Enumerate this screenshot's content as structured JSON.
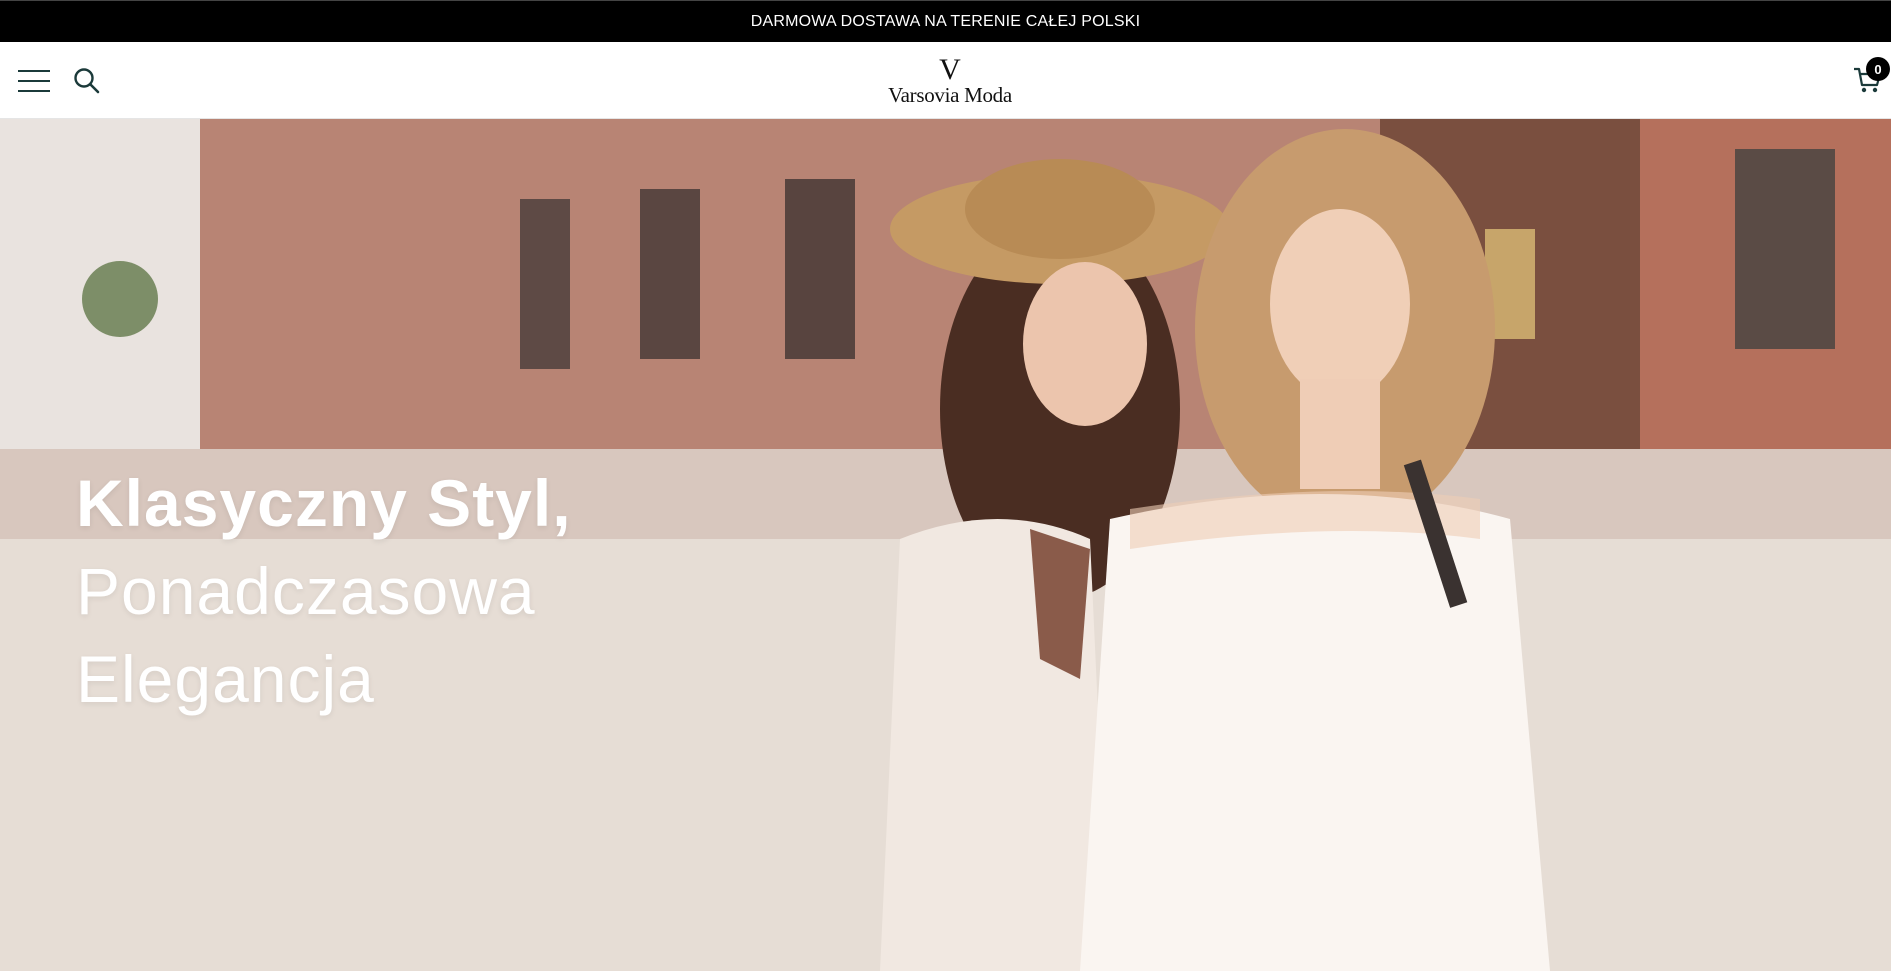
{
  "announcement": {
    "text": "DARMOWA DOSTAWA NA TERENIE CAŁEJ POLSKI"
  },
  "header": {
    "logo_mark": "V",
    "logo_text": "Varsovia Moda",
    "cart_count": "0",
    "icons": {
      "menu": "hamburger-menu-icon",
      "search": "search-icon",
      "cart": "cart-icon"
    }
  },
  "hero": {
    "headline_lines": [
      "Klasyczny Styl,",
      "Ponadczasowa",
      "Elegancja"
    ],
    "image": "two-women-smiling-street"
  },
  "colors": {
    "announcement_bg": "#000000",
    "icon": "#1b3a3a",
    "headline": "#ffffff"
  }
}
